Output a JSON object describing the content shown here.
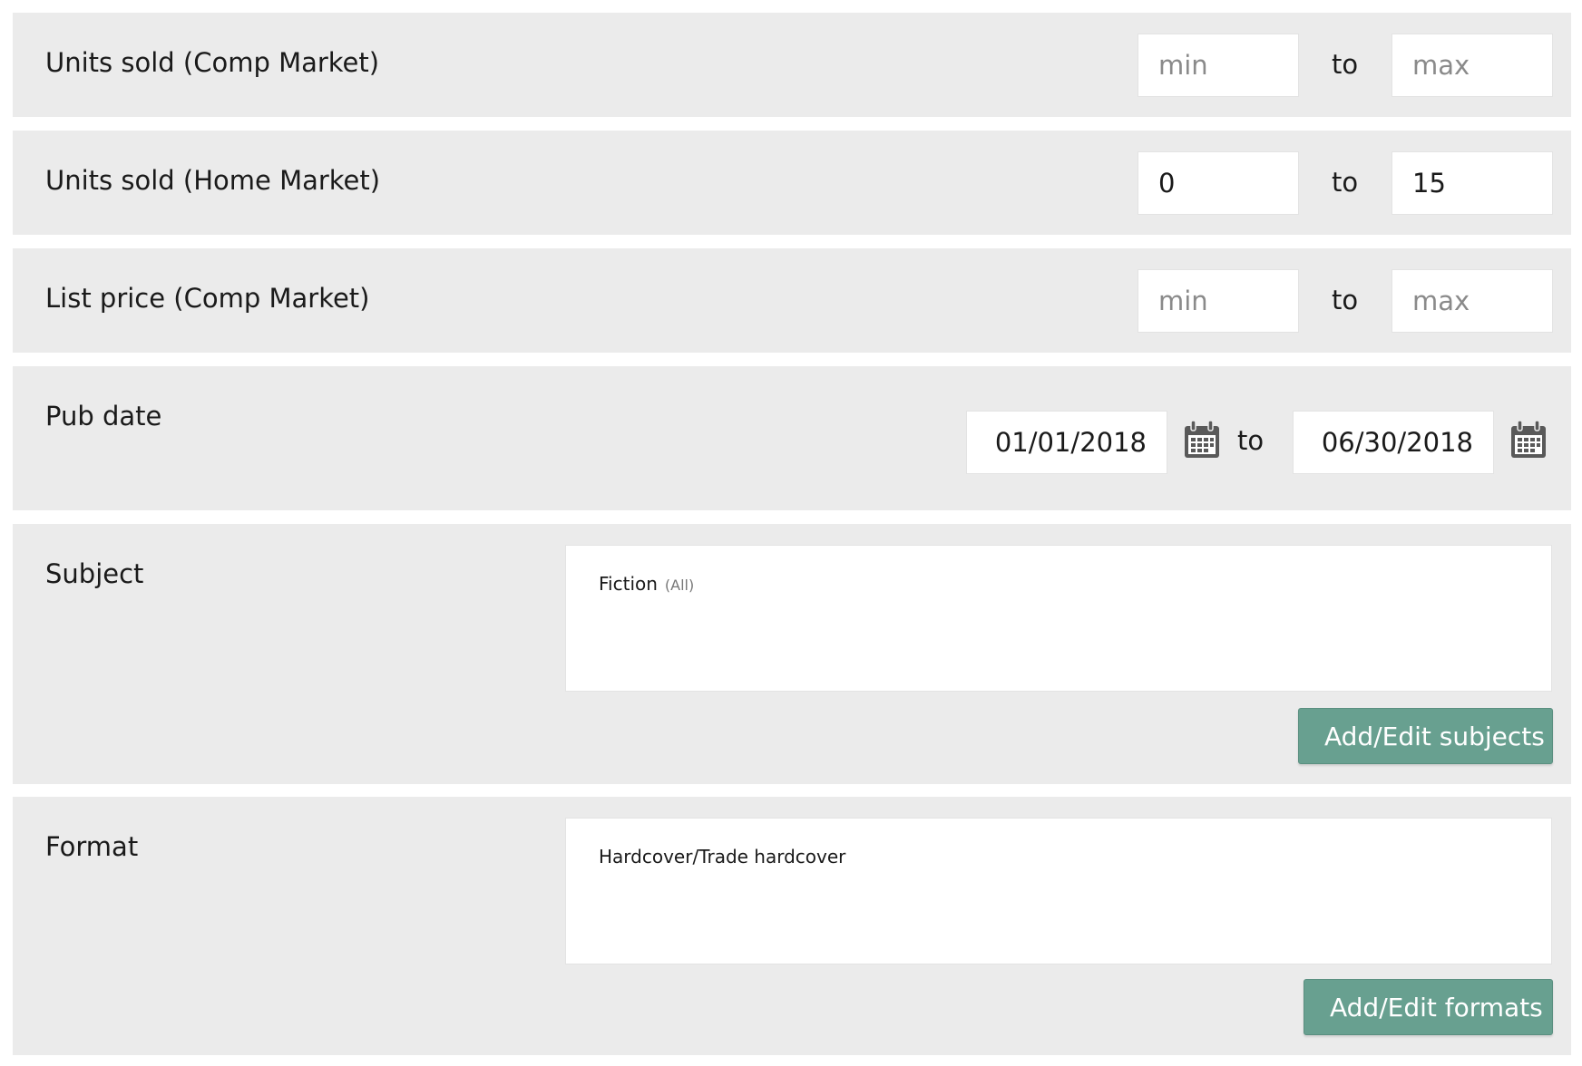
{
  "filters": {
    "units_comp": {
      "label": "Units sold (Comp Market)",
      "min_placeholder": "min",
      "max_placeholder": "max",
      "min_value": "",
      "max_value": "",
      "separator": "to"
    },
    "units_home": {
      "label": "Units sold (Home Market)",
      "min_placeholder": "min",
      "max_placeholder": "max",
      "min_value": "0",
      "max_value": "15",
      "separator": "to"
    },
    "price_comp": {
      "label": "List price (Comp Market)",
      "min_placeholder": "min",
      "max_placeholder": "max",
      "min_value": "",
      "max_value": "",
      "separator": "to"
    },
    "pub_date": {
      "label": "Pub date",
      "start": "01/01/2018",
      "end": "06/30/2018",
      "separator": "to",
      "icon": "calendar-icon"
    },
    "subject": {
      "label": "Subject",
      "items": [
        {
          "name": "Fiction",
          "qualifier": "(All)"
        }
      ],
      "button_label": "Add/Edit subjects"
    },
    "format": {
      "label": "Format",
      "items": [
        {
          "name": "Hardcover/Trade hardcover"
        }
      ],
      "button_label": "Add/Edit formats"
    }
  },
  "colors": {
    "row_background": "#ebebeb",
    "button": "#68a090",
    "button_text": "#ffffff",
    "placeholder": "#8a8a8a",
    "icon": "#595959"
  }
}
